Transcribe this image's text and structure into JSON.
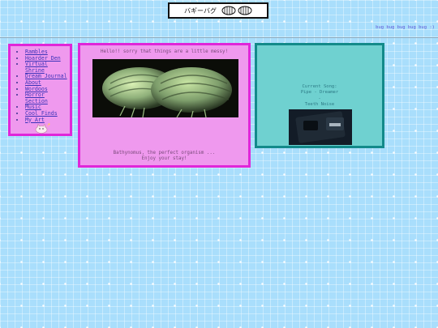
{
  "banner": {
    "title": "バギーバグ",
    "icon_names": [
      "isopod-icon",
      "isopod-icon"
    ]
  },
  "marquee": {
    "text": "bug bug bug bug bug :)"
  },
  "nav": {
    "items": [
      {
        "label": "Rambles"
      },
      {
        "label": "Hoarder Den"
      },
      {
        "label": "Virtual Shrine"
      },
      {
        "label": "Dream Journal"
      },
      {
        "label": "About"
      },
      {
        "label": "Wordoos"
      },
      {
        "label": "Horror Section"
      },
      {
        "label": "Music"
      },
      {
        "label": "Cool Finds"
      },
      {
        "label": "My Art"
      }
    ],
    "image": "cat-gif"
  },
  "main": {
    "greeting": "Hello!! sorry that things are a little messy!",
    "image": "giant-isopod-photo",
    "caption_line1": "Bathynomus, the perfect organism ...",
    "caption_line2": "Enjoy your stay!"
  },
  "music": {
    "heading": "Current Song:",
    "song": "Pipe - Dreamer",
    "separator": "-",
    "artist": "Teeth Noise",
    "image": "album-art"
  },
  "colors": {
    "background": "#a9defc",
    "panel_pink": "#ef99ee",
    "border_magenta": "#e026d9",
    "panel_teal": "#6fd1d0",
    "border_teal": "#138a8a",
    "link": "#3b34b8"
  }
}
